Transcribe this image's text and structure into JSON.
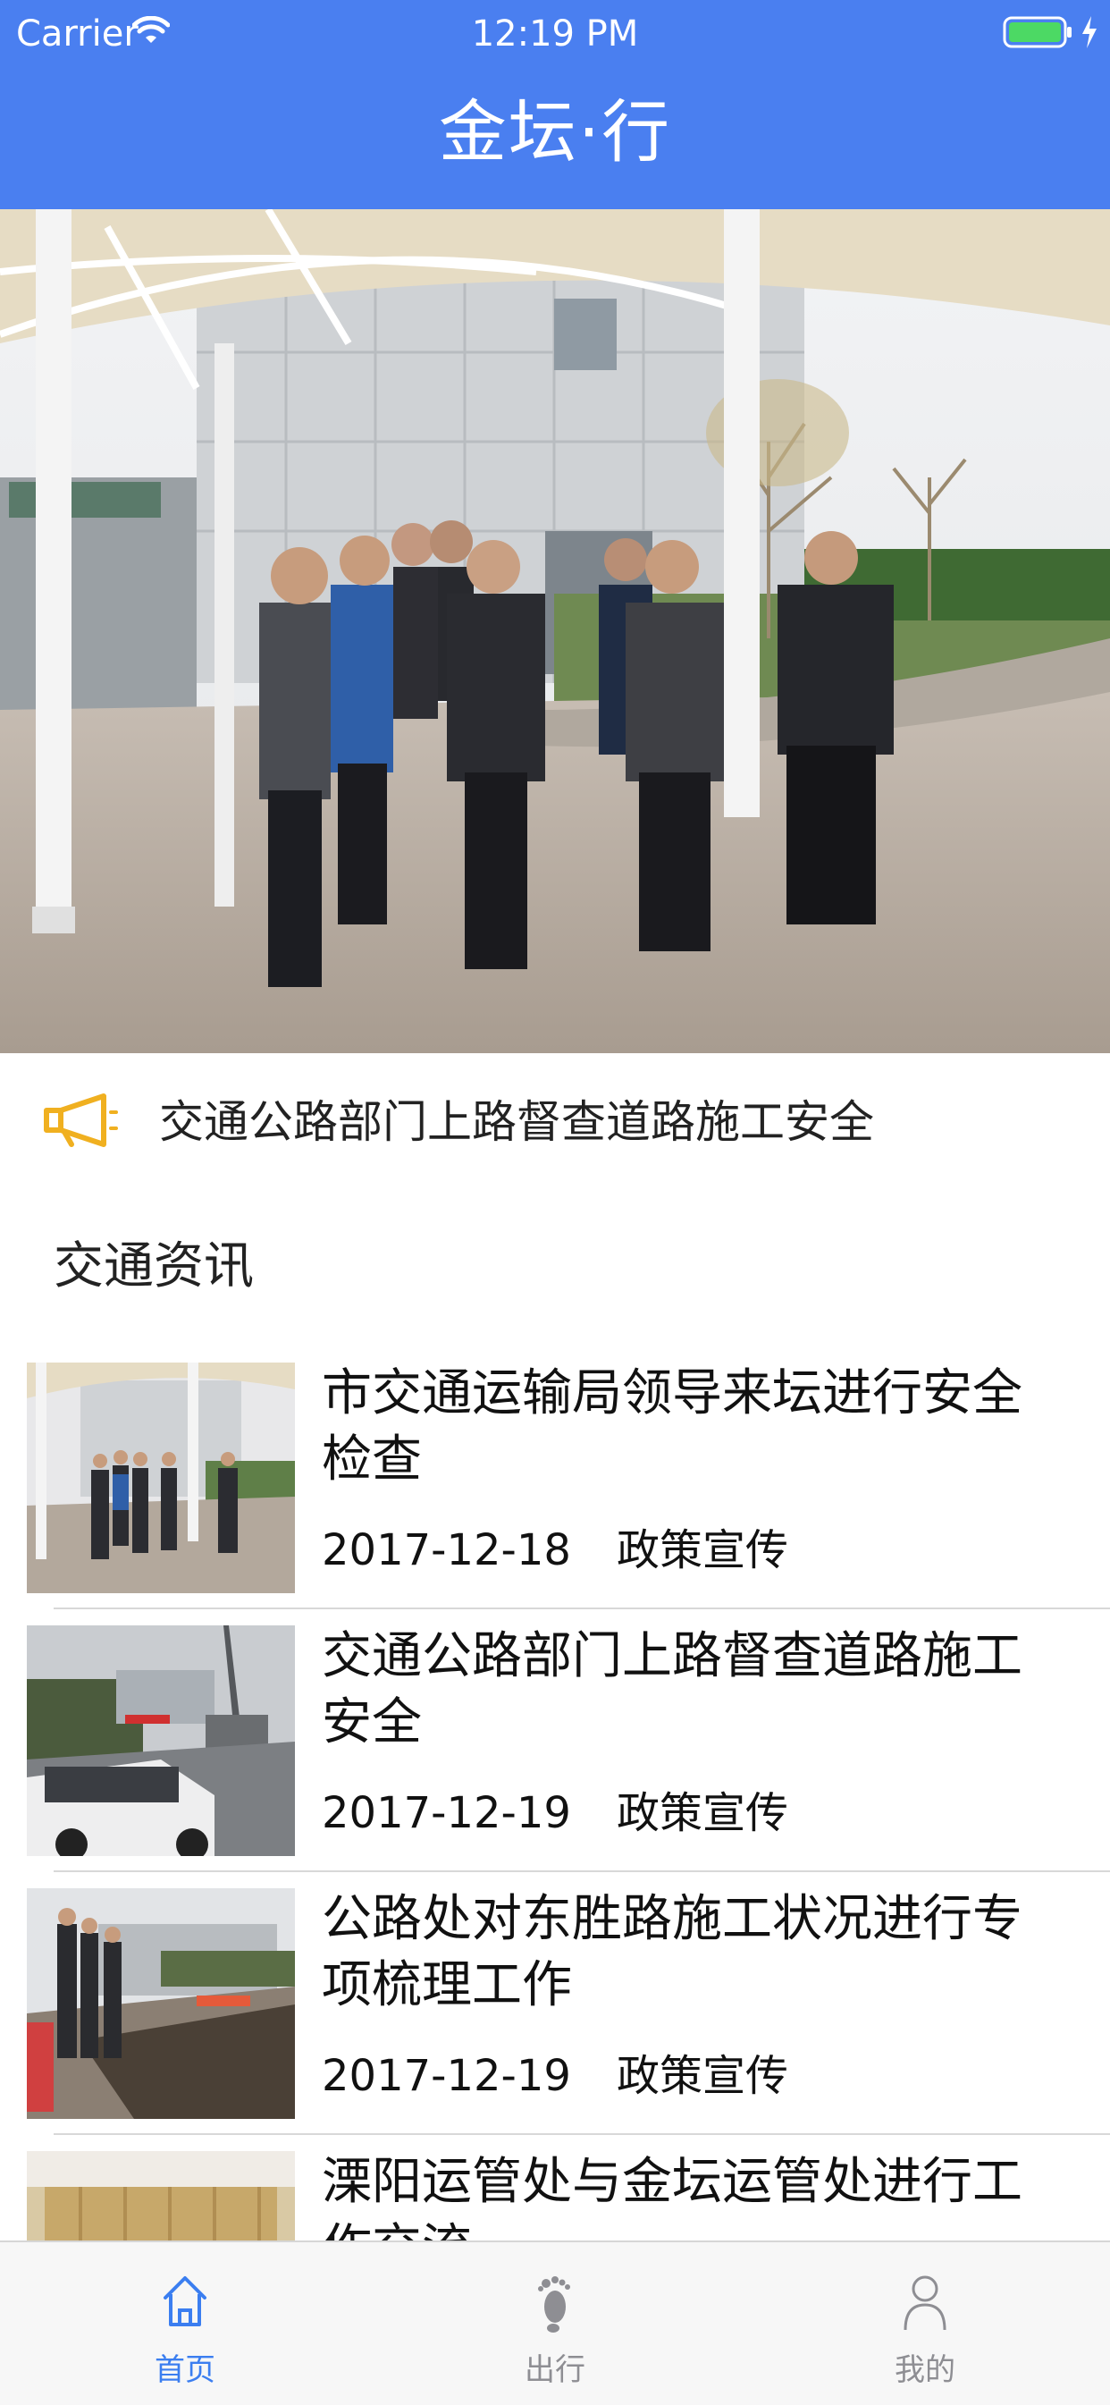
{
  "status_bar": {
    "carrier": "Carrier",
    "time": "12:19 PM"
  },
  "app": {
    "title": "金坛·行",
    "header_color": "#4a7ff0"
  },
  "notice": {
    "icon": "megaphone-icon",
    "text": "交通公路部门上路督查道路施工安全"
  },
  "section": {
    "title": "交通资讯"
  },
  "news": [
    {
      "title": "市交通运输局领导来坛进行安全检查",
      "date": "2017-12-18",
      "category": "政策宣传"
    },
    {
      "title": "交通公路部门上路督查道路施工安全",
      "date": "2017-12-19",
      "category": "政策宣传"
    },
    {
      "title": "公路处对东胜路施工状况进行专项梳理工作",
      "date": "2017-12-19",
      "category": "政策宣传"
    },
    {
      "title": "溧阳运管处与金坛运管处进行工作交流",
      "date": "",
      "category": ""
    }
  ],
  "tabs": [
    {
      "label": "首页",
      "icon": "home-icon",
      "active": true
    },
    {
      "label": "出行",
      "icon": "footprint-icon",
      "active": false
    },
    {
      "label": "我的",
      "icon": "person-icon",
      "active": false
    }
  ],
  "colors": {
    "accent": "#3b7ef0",
    "inactive": "#8e8e93",
    "horn": "#f0b020"
  }
}
